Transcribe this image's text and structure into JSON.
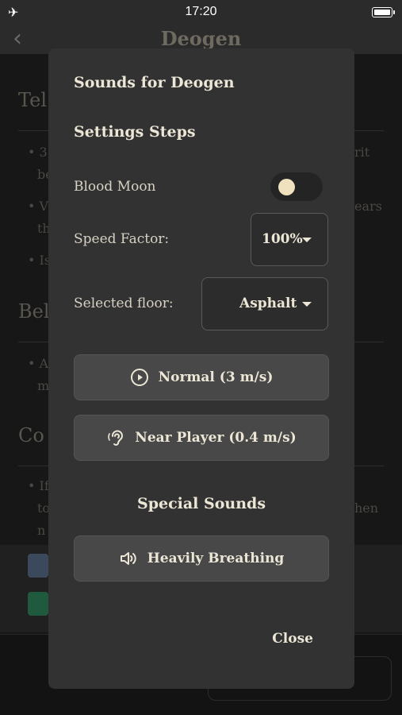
{
  "status_bar": {
    "time": "17:20"
  },
  "nav": {
    "title": "Deogen"
  },
  "background": {
    "headings": [
      "Tel",
      "Bel",
      "Co"
    ],
    "lines": [
      "• 3",
      "be",
      "• V",
      "th",
      "• Is",
      "• A",
      "m",
      "• If",
      "to",
      "n"
    ],
    "right_fragments": [
      "rit",
      "ears",
      "hen"
    ]
  },
  "modal": {
    "title": "Sounds for Deogen",
    "section_title": "Settings Steps",
    "blood_moon": {
      "label": "Blood Moon",
      "enabled": false
    },
    "speed_factor": {
      "label": "Speed Factor:",
      "value": "100%"
    },
    "selected_floor": {
      "label": "Selected floor:",
      "value": "Asphalt"
    },
    "buttons": [
      {
        "label": "Normal (3 m/s)",
        "icon": "play-circle-icon"
      },
      {
        "label": "Near Player (0.4 m/s)",
        "icon": "ear-icon"
      }
    ],
    "special_title": "Special Sounds",
    "special_buttons": [
      {
        "label": "Heavily Breathing",
        "icon": "speaker-icon"
      }
    ],
    "close_label": "Close"
  },
  "colors": {
    "modal_bg": "#323232",
    "button_bg": "#484848",
    "toggle_knob": "#efe1bd",
    "text": "#ece6d6"
  }
}
